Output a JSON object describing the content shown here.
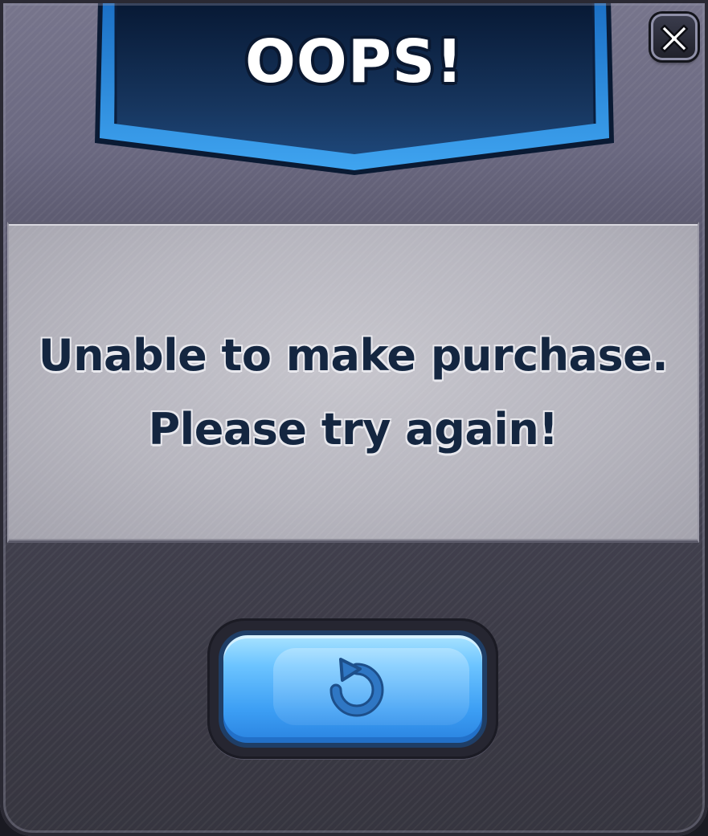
{
  "dialog": {
    "title": "OOPS!",
    "message_line1": "Unable to make purchase.",
    "message_line2": "Please try again!",
    "close_icon": "close-x-icon",
    "retry_icon": "retry-arrow-icon"
  },
  "colors": {
    "ribbon_dark": "#0e2445",
    "ribbon_edge": "#2b8fe0",
    "text_dark": "#142640",
    "button_blue": "#3c9ef4"
  }
}
